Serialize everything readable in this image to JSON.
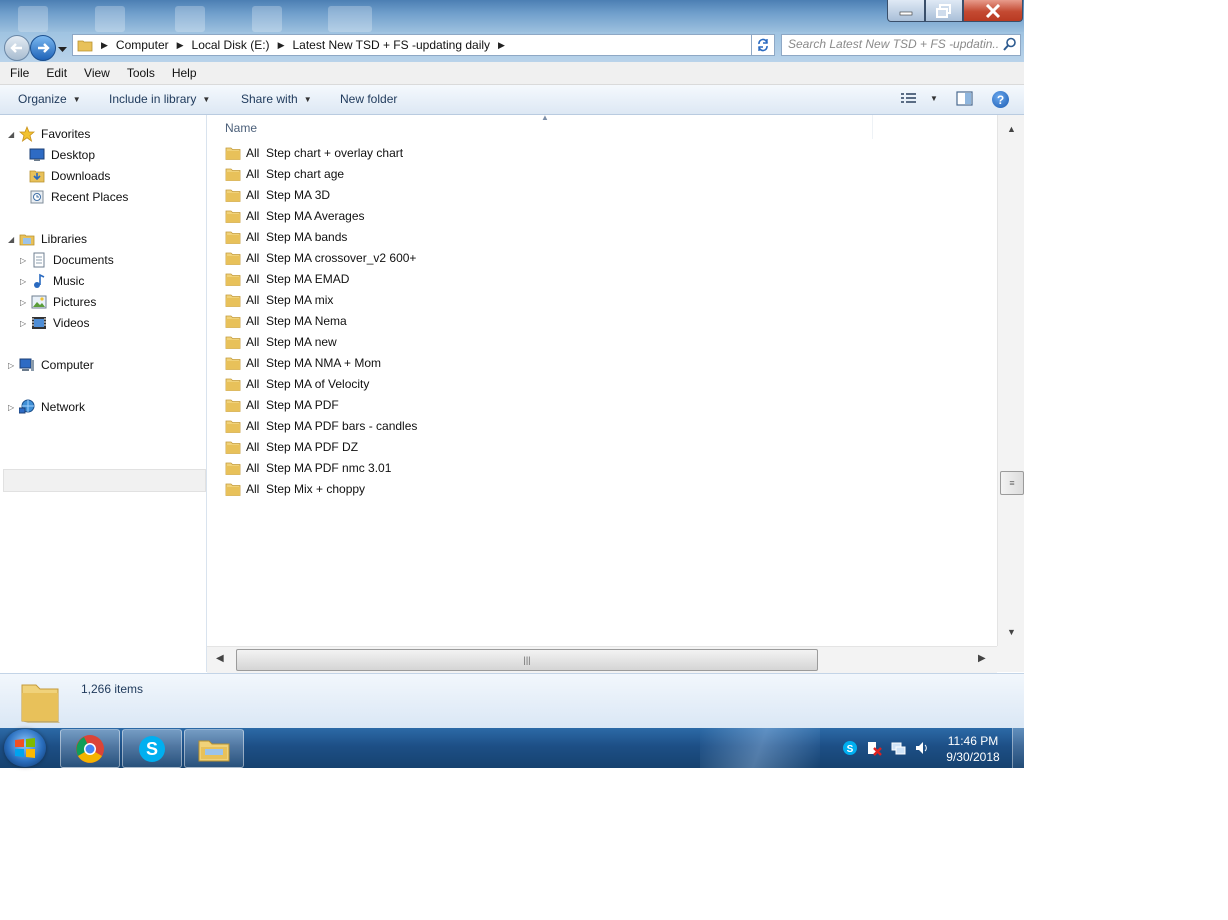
{
  "window": {
    "address": {
      "crumbs": [
        "Computer",
        "Local Disk (E:)",
        "Latest New TSD + FS -updating daily"
      ]
    },
    "search": {
      "placeholder": "Search Latest New TSD + FS -updatin..."
    }
  },
  "menubar": {
    "items": [
      "File",
      "Edit",
      "View",
      "Tools",
      "Help"
    ]
  },
  "commandbar": {
    "organize": "Organize",
    "include_in_library": "Include in library",
    "share_with": "Share with",
    "new_folder": "New folder",
    "help_label": "?"
  },
  "navpane": {
    "favorites": {
      "label": "Favorites",
      "items": [
        "Desktop",
        "Downloads",
        "Recent Places"
      ]
    },
    "libraries": {
      "label": "Libraries",
      "items": [
        "Documents",
        "Music",
        "Pictures",
        "Videos"
      ]
    },
    "computer": "Computer",
    "network": "Network"
  },
  "content": {
    "column_header": "Name",
    "files": [
      "All  Step chart + overlay chart",
      "All  Step chart age",
      "All  Step MA 3D",
      "All  Step MA Averages",
      "All  Step MA bands",
      "All  Step MA crossover_v2 600+",
      "All  Step MA EMAD",
      "All  Step MA mix",
      "All  Step MA Nema",
      "All  Step MA new",
      "All  Step MA NMA + Mom",
      "All  Step MA of Velocity",
      "All  Step MA PDF",
      "All  Step MA PDF bars - candles",
      "All  Step MA PDF DZ",
      "All  Step MA PDF nmc 3.01",
      "All  Step Mix + choppy"
    ]
  },
  "details": {
    "item_count": "1,266 items"
  },
  "taskbar": {
    "pinned": [
      "chrome-icon",
      "skype-icon",
      "explorer-icon"
    ],
    "clock_time": "11:46 PM",
    "clock_date": "9/30/2018"
  },
  "colors": {
    "titlebar": "#6f9ecb",
    "taskbar": "#1d4f86",
    "folder": "#e8c15a",
    "link_text": "#1e395b"
  }
}
